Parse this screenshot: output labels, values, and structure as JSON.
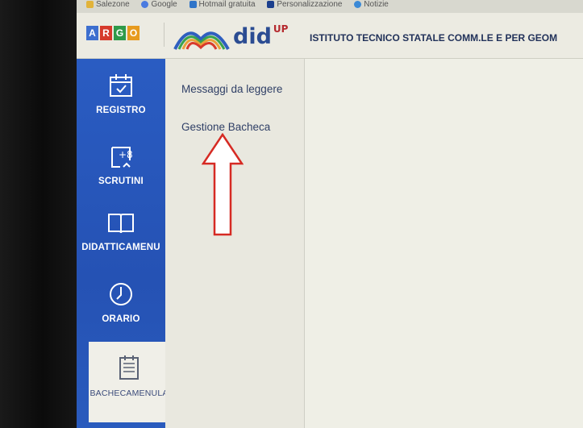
{
  "bookmarks": [
    "Salezone",
    "Google",
    "Hotmail gratuita",
    "Personalizzazione",
    "Notizie"
  ],
  "header": {
    "argo_letters": [
      "A",
      "R",
      "G",
      "O"
    ],
    "argo_colors": [
      "#3d6fcf",
      "#d63a2b",
      "#2f9a4a",
      "#e79b1f"
    ],
    "app_name": "did",
    "app_sup": "UP",
    "school_name": "ISTITUTO TECNICO STATALE COMM.LE E PER GEOM"
  },
  "sidebar": {
    "items": [
      {
        "label": "REGISTRO",
        "icon": "calendar-check-icon"
      },
      {
        "label": "SCRUTINI",
        "icon": "document-plus8-icon"
      },
      {
        "label": "DIDATTICAMENU",
        "icon": "open-book-icon"
      },
      {
        "label": "ORARIO",
        "icon": "clock-icon"
      },
      {
        "label": "BACHECAMENULA",
        "icon": "notepad-icon",
        "active": true
      }
    ]
  },
  "submenu": {
    "items": [
      {
        "label": "Messaggi da leggere"
      },
      {
        "label": "Gestione Bacheca"
      }
    ]
  },
  "annotation": {
    "color": "#d62a23",
    "icon": "up-arrow-annotation"
  }
}
